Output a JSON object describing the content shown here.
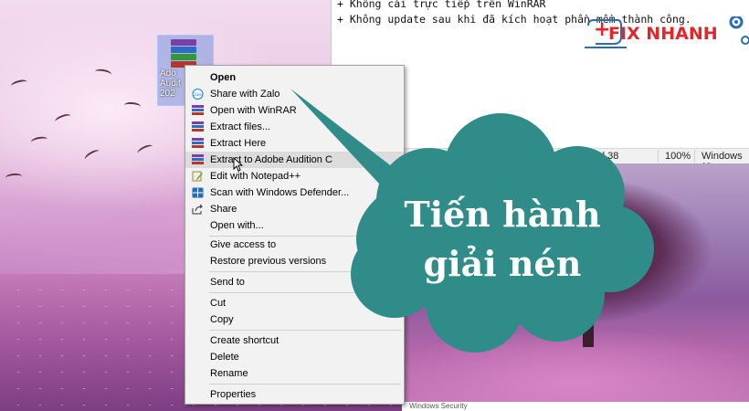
{
  "notepad": {
    "lines": [
      "+ Không cài trực tiếp trên WinRAR",
      "+ Không update sau khi đã kích hoạt phần mềm thành công."
    ],
    "status": {
      "position": "Ln 7, Col 38",
      "zoom": "100%",
      "line_ending": "Windows (C"
    }
  },
  "photo_caption": "Windows Security",
  "desktop_icon": {
    "label": "Ado\nAudit\n202",
    "icon": "winrar-archive-icon"
  },
  "context_menu": {
    "items": [
      {
        "label": "Open",
        "icon": "",
        "bold": true
      },
      {
        "label": "Share with Zalo",
        "icon": "zalo-icon"
      },
      {
        "label": "Open with WinRAR",
        "icon": "winrar-icon"
      },
      {
        "label": "Extract files...",
        "icon": "winrar-icon"
      },
      {
        "label": "Extract Here",
        "icon": "winrar-icon"
      },
      {
        "label": "Extract to Adobe Audition C",
        "icon": "winrar-icon",
        "hover": true
      },
      {
        "label": "Edit with Notepad++",
        "icon": "notepadpp-icon"
      },
      {
        "label": "Scan with Windows Defender...",
        "icon": "defender-icon"
      },
      {
        "label": "Share",
        "icon": "share-icon"
      },
      {
        "label": "Open with...",
        "icon": ""
      },
      {
        "label": "Give access to",
        "icon": "",
        "submenu": true
      },
      {
        "label": "Restore previous versions",
        "icon": ""
      },
      {
        "label": "Send to",
        "icon": "",
        "submenu": true
      },
      {
        "label": "Cut",
        "icon": ""
      },
      {
        "label": "Copy",
        "icon": ""
      },
      {
        "label": "Create shortcut",
        "icon": ""
      },
      {
        "label": "Delete",
        "icon": ""
      },
      {
        "label": "Rename",
        "icon": ""
      },
      {
        "label": "Properties",
        "icon": ""
      }
    ]
  },
  "callout": {
    "line1": "Tiến hành",
    "line2": "giải nén",
    "color": "#2f8c88"
  },
  "brand": {
    "plus": "+",
    "name": "FIX NHANH",
    "color": "#e3262b"
  },
  "colors": {
    "menu_bg": "#f2f2f2",
    "menu_hover": "#dcdcdc"
  }
}
